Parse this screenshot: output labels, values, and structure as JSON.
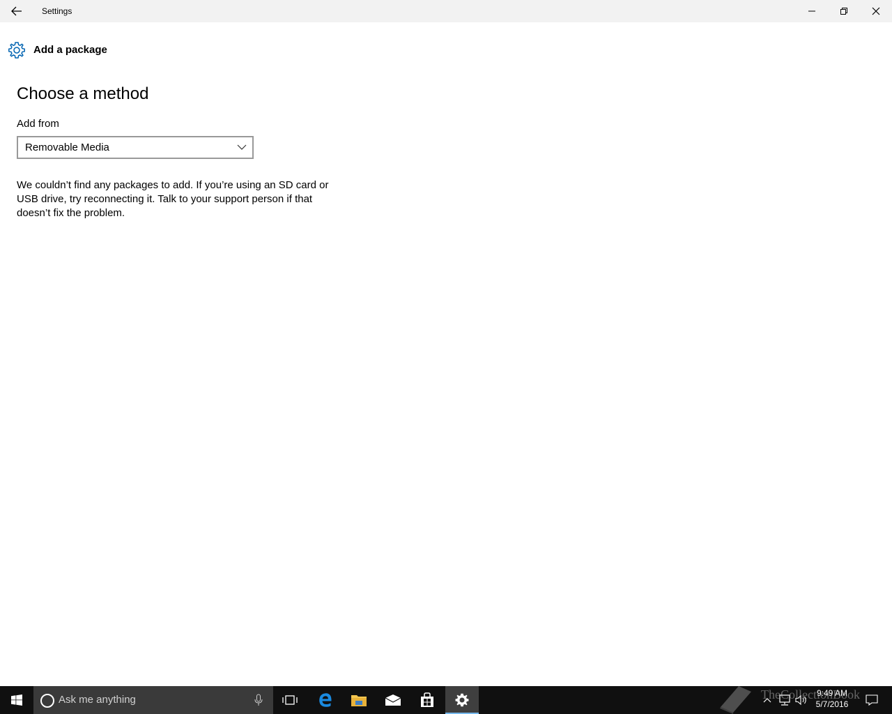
{
  "window": {
    "title": "Settings",
    "back_icon": "back-arrow-icon",
    "controls": [
      "minimize-icon",
      "restore-icon",
      "close-icon"
    ]
  },
  "header": {
    "icon": "gear-icon",
    "title": "Add a package",
    "accent_color": "#0063b1"
  },
  "main": {
    "heading": "Choose a method",
    "add_from_label": "Add from",
    "add_from_value": "Removable Media",
    "message": "We couldn’t find any packages to add. If you’re using an SD card or USB drive, try reconnecting it. Talk to your support person if that doesn’t fix the problem."
  },
  "taskbar": {
    "search_placeholder": "Ask me anything",
    "apps": [
      "task-view-icon",
      "edge-icon",
      "file-explorer-icon",
      "mail-icon",
      "store-icon",
      "settings-icon"
    ],
    "active_app": "settings-icon",
    "tray_icons": [
      "chevron-up-icon",
      "network-icon",
      "volume-icon",
      "action-center-icon"
    ],
    "time": "9:49 AM",
    "date": "5/7/2016",
    "watermark": "TheCollectionBook"
  }
}
